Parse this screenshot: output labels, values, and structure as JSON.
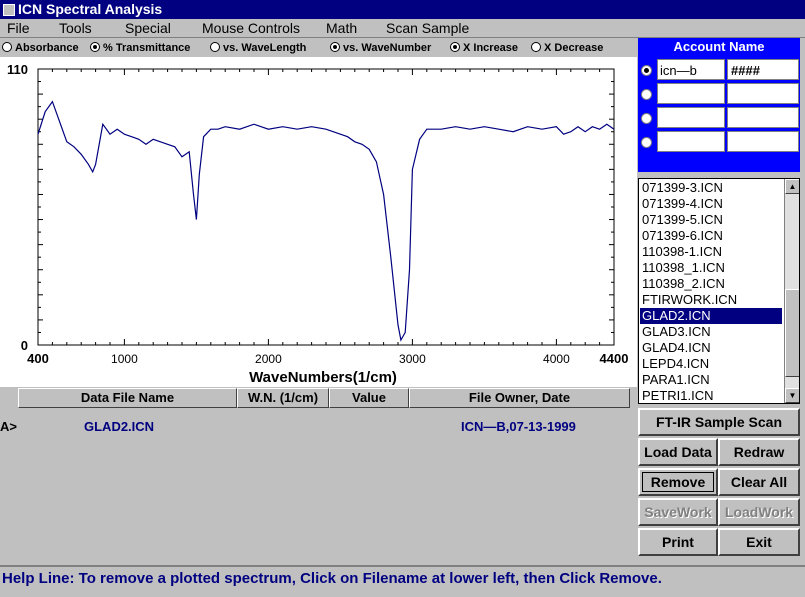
{
  "window": {
    "title": "ICN Spectral Analysis"
  },
  "menu": [
    "File",
    "Tools",
    "Special",
    "Mouse Controls",
    "Math",
    "Scan Sample"
  ],
  "options": [
    {
      "label": "Absorbance",
      "checked": false
    },
    {
      "label": "% Transmittance",
      "checked": true
    },
    {
      "label": "vs. WaveLength",
      "checked": false
    },
    {
      "label": "vs. WaveNumber",
      "checked": true
    },
    {
      "label": "X Increase",
      "checked": true
    },
    {
      "label": "X Decrease",
      "checked": false
    }
  ],
  "account": {
    "title": "Account Name",
    "rows": [
      {
        "name": "icn—b",
        "password": "####",
        "selected": true
      },
      {
        "name": "",
        "password": "",
        "selected": false
      },
      {
        "name": "",
        "password": "",
        "selected": false
      },
      {
        "name": "",
        "password": "",
        "selected": false
      }
    ]
  },
  "files": [
    "071399-3.ICN",
    "071399-4.ICN",
    "071399-5.ICN",
    "071399-6.ICN",
    "110398-1.ICN",
    "110398_1.ICN",
    "110398_2.ICN",
    "FTIRWORK.ICN",
    "GLAD2.ICN",
    "GLAD3.ICN",
    "GLAD4.ICN",
    "LEPD4.ICN",
    "PARA1.ICN",
    "PETRI1.ICN"
  ],
  "selected_file": "GLAD2.ICN",
  "buttons": {
    "scan": "FT-IR Sample Scan",
    "load": "Load Data",
    "redraw": "Redraw",
    "remove": "Remove",
    "clear": "Clear All",
    "savework": "SaveWork",
    "loadwork": "LoadWork",
    "print": "Print",
    "exit": "Exit"
  },
  "table": {
    "headers": [
      "Data File Name",
      "W.N. (1/cm)",
      "Value",
      "File Owner,  Date"
    ],
    "rows": [
      {
        "marker": "A>",
        "file": "GLAD2.ICN",
        "wn": "",
        "value": "",
        "owner": "ICN—B,07-13-1999"
      }
    ]
  },
  "help": "Help Line: To remove a plotted spectrum, Click on Filename at lower left, then Click Remove.",
  "chart_data": {
    "type": "line",
    "xlabel": "WaveNumbers(1/cm)",
    "ylabel": "",
    "xlim": [
      400,
      4400
    ],
    "ylim": [
      0,
      110
    ],
    "x_ticks": [
      400,
      1000,
      2000,
      3000,
      4000,
      4400
    ],
    "y_ticks": [
      0,
      110
    ],
    "grid": false,
    "line_color": "#000080",
    "series": [
      {
        "x": [
          400,
          450,
          500,
          550,
          600,
          650,
          700,
          750,
          780,
          800,
          850,
          900,
          950,
          1000,
          1050,
          1100,
          1150,
          1200,
          1250,
          1300,
          1350,
          1400,
          1450,
          1480,
          1500,
          1520,
          1550,
          1600,
          1650,
          1700,
          1800,
          1900,
          2000,
          2100,
          2200,
          2300,
          2400,
          2500,
          2550,
          2600,
          2650,
          2700,
          2750,
          2800,
          2850,
          2900,
          2920,
          2950,
          2980,
          3000,
          3050,
          3100,
          3200,
          3300,
          3400,
          3500,
          3600,
          3700,
          3800,
          3900,
          4000,
          4050,
          4100,
          4150,
          4200,
          4250,
          4300,
          4350,
          4400
        ],
        "y": [
          84,
          93,
          97,
          89,
          81,
          79,
          76,
          72,
          69,
          72,
          88,
          84,
          86,
          84,
          83,
          82,
          80,
          82,
          81,
          80,
          79,
          75,
          77,
          60,
          50,
          68,
          83,
          86,
          86,
          87,
          86,
          88,
          86,
          87,
          86,
          87,
          86,
          84,
          83,
          81,
          80,
          78,
          73,
          60,
          35,
          8,
          2,
          5,
          30,
          70,
          82,
          86,
          86,
          87,
          86,
          87,
          86,
          85,
          87,
          86,
          87,
          84,
          85,
          87,
          85,
          87,
          86,
          88,
          86
        ]
      }
    ]
  }
}
